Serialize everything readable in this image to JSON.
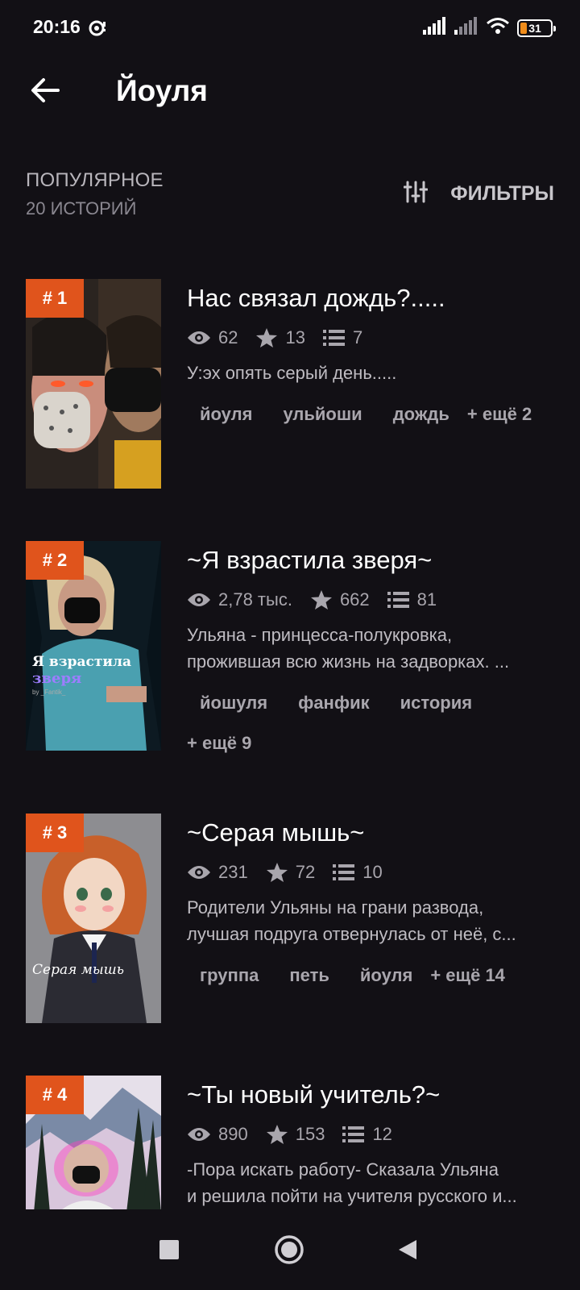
{
  "status_bar": {
    "time": "20:16",
    "battery": "31"
  },
  "header": {
    "title": "Йоуля"
  },
  "section": {
    "title": "ПОПУЛЯРНОЕ",
    "subtitle": "20 ИСТОРИЙ",
    "filters_label": "ФИЛЬТРЫ"
  },
  "stories": [
    {
      "rank": "# 1",
      "title": "Нас связал дождь?.....",
      "views": "62",
      "stars": "13",
      "parts": "7",
      "description": [
        "У:эх опять серый день....."
      ],
      "tags": [
        "йоуля",
        "ульйоши",
        "дождь"
      ],
      "more": "+ ещё 2"
    },
    {
      "rank": "# 2",
      "title": "~Я взрастила зверя~",
      "views": "2,78 тыс.",
      "stars": "662",
      "parts": "81",
      "description": [
        "Ульяна - принцесса-полукровка,",
        "прожившая всю жизнь на задворках. ..."
      ],
      "tags": [
        "йошуля",
        "фанфик",
        "история"
      ],
      "more": "+ ещё 9",
      "cover_text": "Я взрастила",
      "cover_text2": "зверя",
      "cover_text3": "by _Fantik_"
    },
    {
      "rank": "# 3",
      "title": "~Серая мышь~",
      "views": "231",
      "stars": "72",
      "parts": "10",
      "description": [
        "Родители Ульяны на грани развода,",
        "лучшая подруга отвернулась от неё, с..."
      ],
      "tags": [
        "группа",
        "петь",
        "йоуля"
      ],
      "more": "+ ещё 14",
      "cover_text": "Серая мышь"
    },
    {
      "rank": "# 4",
      "title": "~Ты новый учитель?~",
      "views": "890",
      "stars": "153",
      "parts": "12",
      "description": [
        "-Пора искать работу- Сказала Ульяна",
        "и решила пойти на учителя русского и..."
      ]
    }
  ],
  "colors": {
    "background": "#121015",
    "accent": "#e0541c",
    "muted": "#a9a6ad"
  }
}
